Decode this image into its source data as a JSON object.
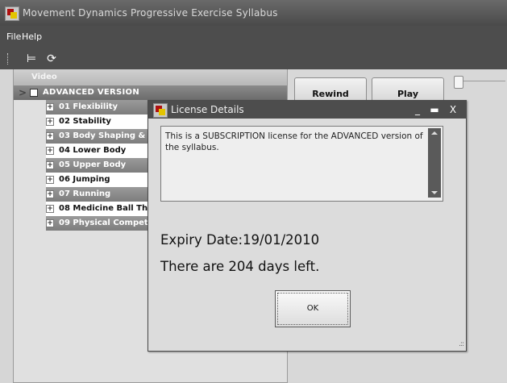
{
  "window": {
    "title": "Movement Dynamics Progressive Exercise Syllabus"
  },
  "menu": {
    "file": "File",
    "help": "Help"
  },
  "toolbar": {
    "collapse_icon": "tree-collapse-icon",
    "refresh_icon": "refresh-icon"
  },
  "tree": {
    "header": "Video",
    "root_expand_glyph": ">",
    "root_label": "ADVANCED VERSION",
    "items": [
      "01 Flexibility",
      "02 Stability",
      "03 Body Shaping & C",
      "04 Lower Body",
      "05 Upper Body",
      "06 Jumping",
      "07 Running",
      "08 Medicine Ball Thr",
      "09 Physical Compete"
    ]
  },
  "player": {
    "rewind_label": "Rewind",
    "play_label": "Play"
  },
  "dialog": {
    "title": "License Details",
    "minimize_glyph": "_",
    "maximize_glyph": "▬",
    "close_glyph": "X",
    "message": "This is a SUBSCRIPTION license for the ADVANCED version of the syllabus.",
    "expiry": "Expiry Date:19/01/2010",
    "days_left": "There are 204 days left.",
    "ok_label": "OK",
    "resize_glyph": ".::"
  }
}
